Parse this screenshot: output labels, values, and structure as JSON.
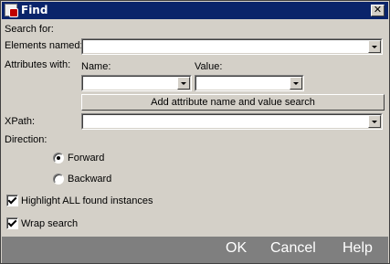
{
  "window": {
    "title": "Find",
    "close_symbol": "✕"
  },
  "search": {
    "heading": "Search for:",
    "elements_named_label": "Elements named:",
    "elements_named_value": "",
    "attributes_label": "Attributes with:",
    "name_header": "Name:",
    "value_header": "Value:",
    "attr_name_value": "",
    "attr_value_value": "",
    "add_attr_button": "Add attribute name and value search",
    "xpath_label": "XPath:",
    "xpath_value": ""
  },
  "direction": {
    "label": "Direction:",
    "forward": "Forward",
    "backward": "Backward",
    "selected": "Forward"
  },
  "options": {
    "highlight_label": "Highlight ALL found instances",
    "highlight_checked": true,
    "wrap_label": "Wrap search",
    "wrap_checked": true
  },
  "footer": {
    "ok": "OK",
    "cancel": "Cancel",
    "help": "Help"
  }
}
